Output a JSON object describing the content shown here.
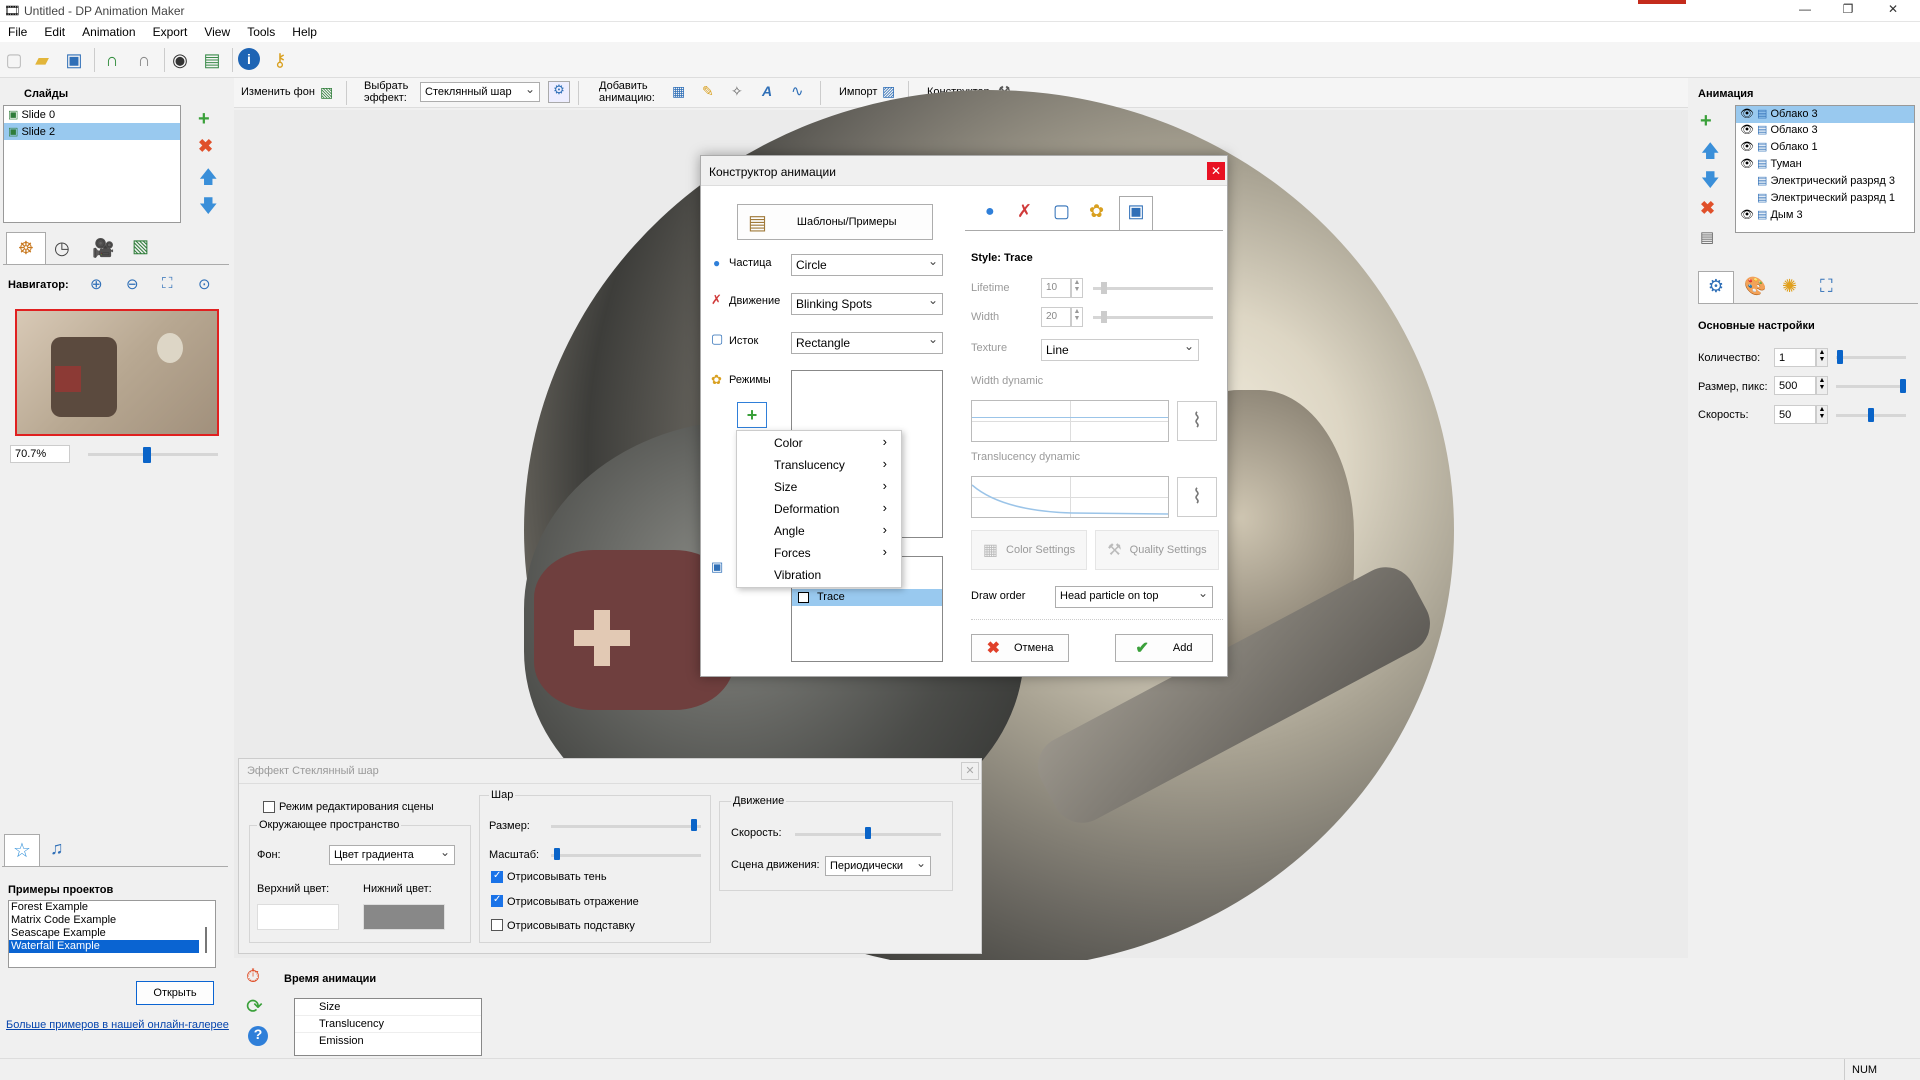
{
  "window": {
    "title": "Untitled - DP Animation Maker",
    "controls": [
      "—",
      "❐",
      "✕"
    ]
  },
  "menu": [
    "File",
    "Edit",
    "Animation",
    "Export",
    "View",
    "Tools",
    "Help"
  ],
  "toolbar2": {
    "change_bg": "Изменить фон",
    "select_effect_l1": "Выбрать",
    "select_effect_l2": "эффект:",
    "effect_value": "Стеклянный шар",
    "add_anim_l1": "Добавить",
    "add_anim_l2": "анимацию:",
    "import": "Импорт",
    "constructor": "Конструктор"
  },
  "left": {
    "slides_title": "Слайды",
    "slides": [
      "Slide 0",
      "Slide 2"
    ],
    "navigator": "Навигатор:",
    "zoom": "70.7%",
    "zoom_level": 0.44,
    "examples_title": "Примеры проектов",
    "examples": [
      "Forest Example",
      "Matrix Code Example",
      "Seascape Example",
      "Waterfall Example"
    ],
    "open_btn": "Открыть",
    "gallery_link": "Больше примеров в нашей онлайн-галерее"
  },
  "right": {
    "anim_title": "Анимация",
    "layers": [
      "Облако 3",
      "Облако 3",
      "Облако 1",
      "Туман",
      "Электрический разряд 3",
      "Электрический разряд 1",
      "Дым 3"
    ],
    "settings_title": "Основные настройки",
    "count_label": "Количество:",
    "count_value": "1",
    "count_level": 0.02,
    "size_label": "Размер, пикс:",
    "size_value": "500",
    "size_level": 1.0,
    "speed_label": "Скорость:",
    "speed_value": "50",
    "speed_level": 0.5
  },
  "dialog": {
    "title": "Конструктор анимации",
    "templates_btn": "Шаблоны/Примеры",
    "particle_label": "Частица",
    "particle_value": "Circle",
    "motion_label": "Движение",
    "motion_value": "Blinking Spots",
    "source_label": "Исток",
    "source_value": "Rectangle",
    "modes_label": "Режимы",
    "style_list": [
      "Trace"
    ],
    "style_title": "Style: Trace",
    "lifetime_label": "Lifetime",
    "lifetime_value": "10",
    "width_label": "Width",
    "width_value": "20",
    "texture_label": "Texture",
    "texture_value": "Line",
    "width_dynamic": "Width dynamic",
    "translucency_dynamic": "Translucency dynamic",
    "color_settings": "Color Settings",
    "quality_settings": "Quality Settings",
    "draw_order_label": "Draw order",
    "draw_order_value": "Head particle on top",
    "cancel": "Отмена",
    "add": "Add"
  },
  "context_menu": [
    {
      "label": "Color",
      "sub": true
    },
    {
      "label": "Translucency",
      "sub": true
    },
    {
      "label": "Size",
      "sub": true
    },
    {
      "label": "Deformation",
      "sub": true
    },
    {
      "label": "Angle",
      "sub": true
    },
    {
      "label": "Forces",
      "sub": true
    },
    {
      "label": "Vibration",
      "sub": false
    }
  ],
  "effect_panel": {
    "title": "Эффект Стеклянный шар",
    "edit_mode": "Режим редактирования сцены",
    "env": "Окружающее пространство",
    "bg_label": "Фон:",
    "bg_value": "Цвет градиента",
    "top_color": "Верхний цвет:",
    "bottom_color": "Нижний цвет:",
    "top_color_hex": "#ffffff",
    "bottom_color_hex": "#888888",
    "ball": "Шар",
    "size": "Размер:",
    "size_level": 0.97,
    "scale": "Масштаб:",
    "scale_level": 0.02,
    "shadow": "Отрисовывать тень",
    "reflection": "Отрисовывать отражение",
    "stand": "Отрисовывать подставку",
    "motion": "Движение",
    "speed": "Скорость:",
    "speed_level": 0.5,
    "scene": "Сцена движения:",
    "scene_value": "Периодически"
  },
  "timeline": {
    "title": "Время анимации",
    "rows": [
      "Size",
      "Translucency",
      "Emission"
    ]
  },
  "status": {
    "num": "NUM"
  }
}
